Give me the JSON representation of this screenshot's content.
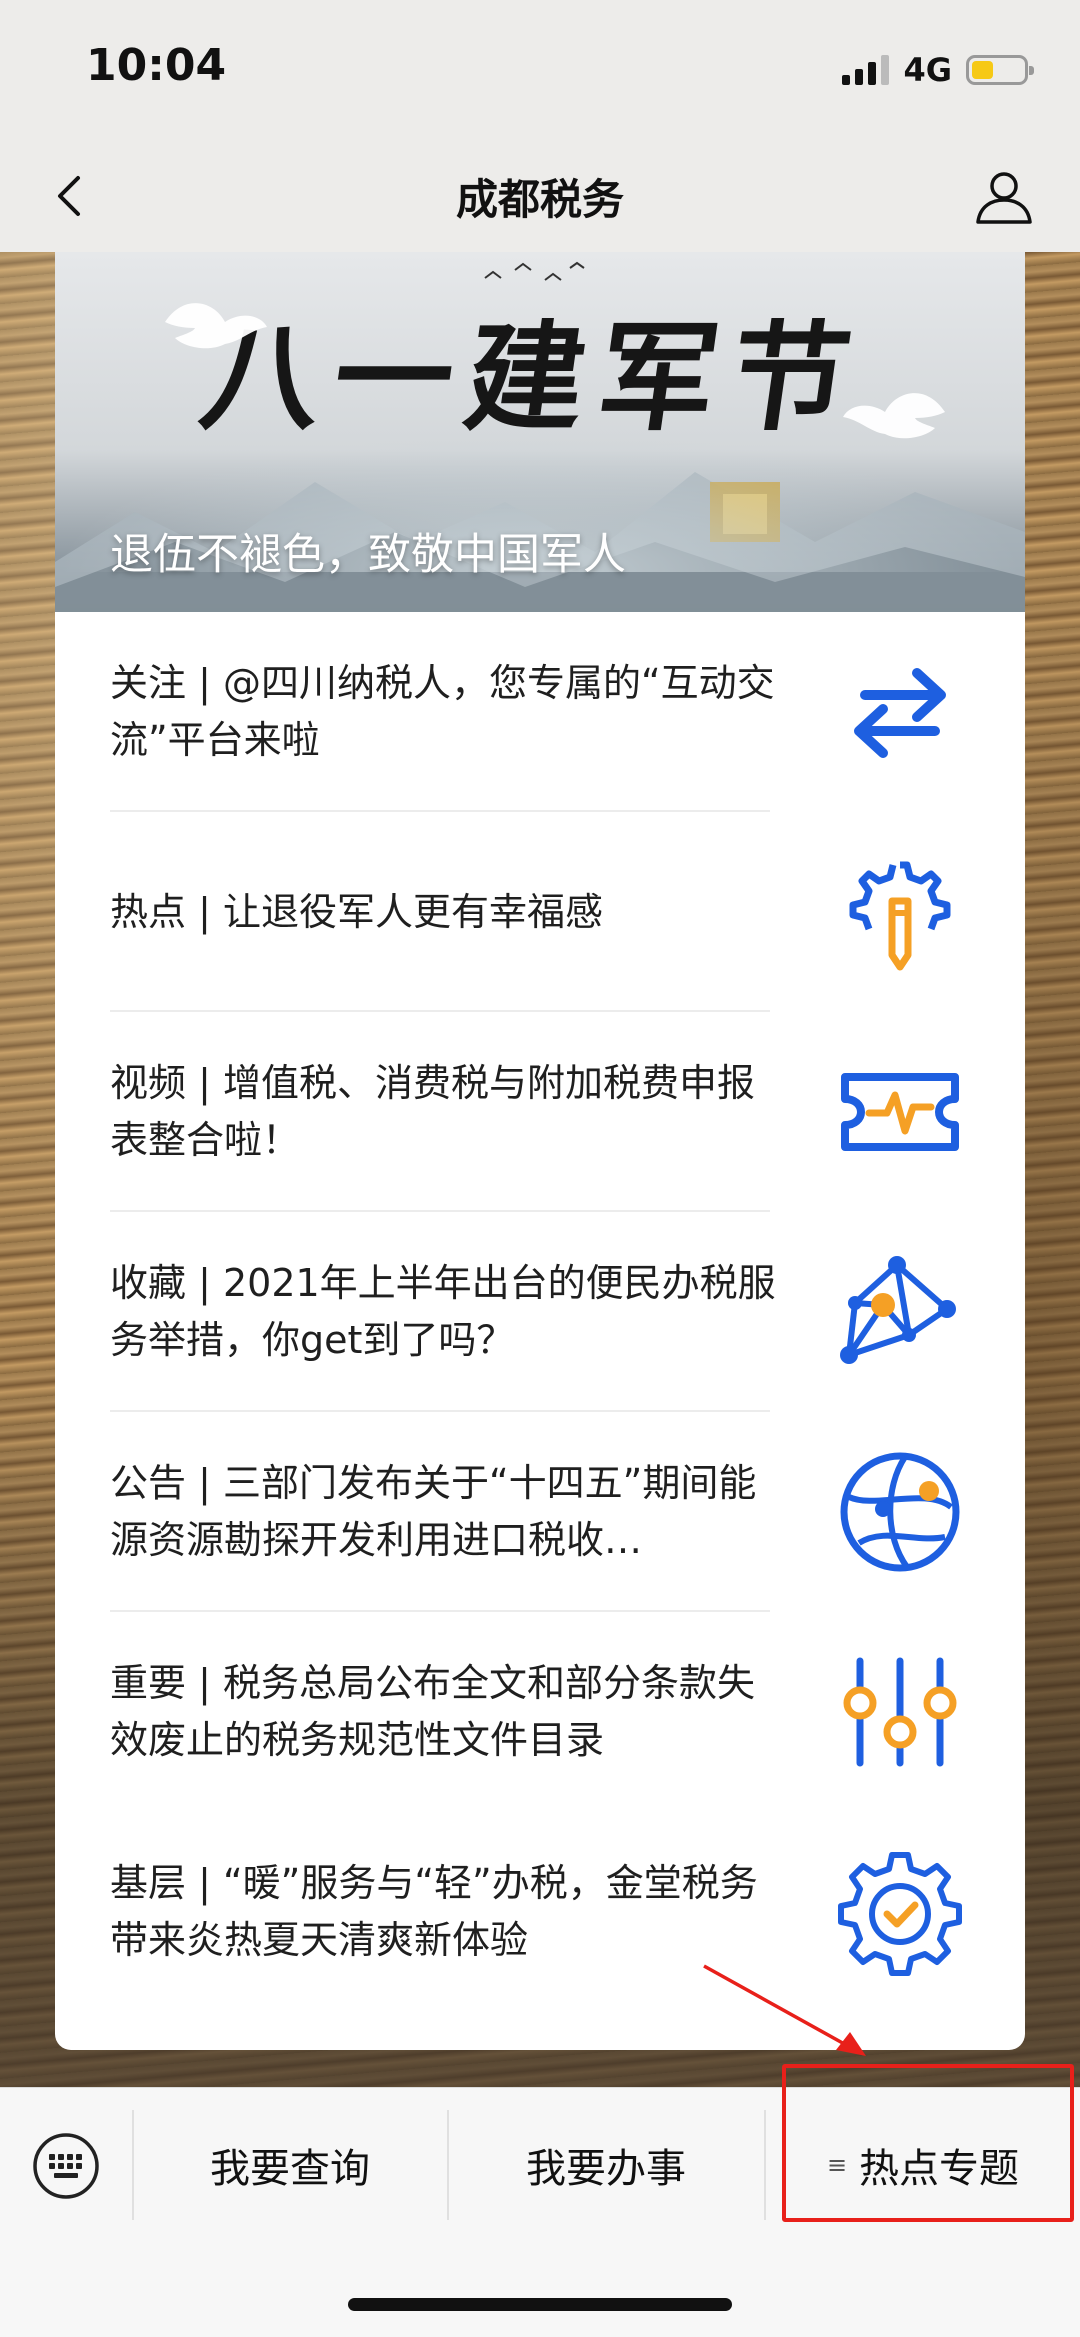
{
  "status_bar": {
    "time": "10:04",
    "network": "4G",
    "battery_level": 0.42,
    "battery_color": "#f6c915"
  },
  "nav": {
    "title": "成都税务",
    "back_icon": "chevron-left-icon",
    "profile_icon": "person-icon"
  },
  "banner": {
    "calligraphy": "八一建军节",
    "subtitle": "退伍不褪色，致敬中国军人"
  },
  "articles": [
    {
      "text": "关注 | @四川纳税人，您专属的“互动交流”平台来啦",
      "icon": "exchange-arrows-icon"
    },
    {
      "text": "热点 | 让退役军人更有幸福感",
      "icon": "gear-pencil-icon"
    },
    {
      "text": "视频 | 增值税、消费税与附加税费申报表整合啦！",
      "icon": "ticket-pulse-icon"
    },
    {
      "text": "收藏 | 2021年上半年出台的便民办税服务举措，你get到了吗？",
      "icon": "network-nodes-icon"
    },
    {
      "text": "公告 | 三部门发布关于“十四五”期间能源资源勘探开发利用进口税收…",
      "icon": "globe-icon"
    },
    {
      "text": "重要 | 税务总局公布全文和部分条款失效废止的税务规范性文件目录",
      "icon": "sliders-icon"
    },
    {
      "text": "基层 | “暖”服务与“轻”办税，金堂税务带来炎热夏天清爽新体验",
      "icon": "gear-check-icon"
    }
  ],
  "bottom_menu": {
    "keyboard_icon": "keyboard-icon",
    "items": [
      "我要查询",
      "我要办事",
      "热点专题"
    ],
    "submenu_indicator": "≡"
  },
  "colors": {
    "icon_blue": "#1e5fe0",
    "icon_orange": "#f5a025",
    "annotation_red": "#e8201a"
  }
}
